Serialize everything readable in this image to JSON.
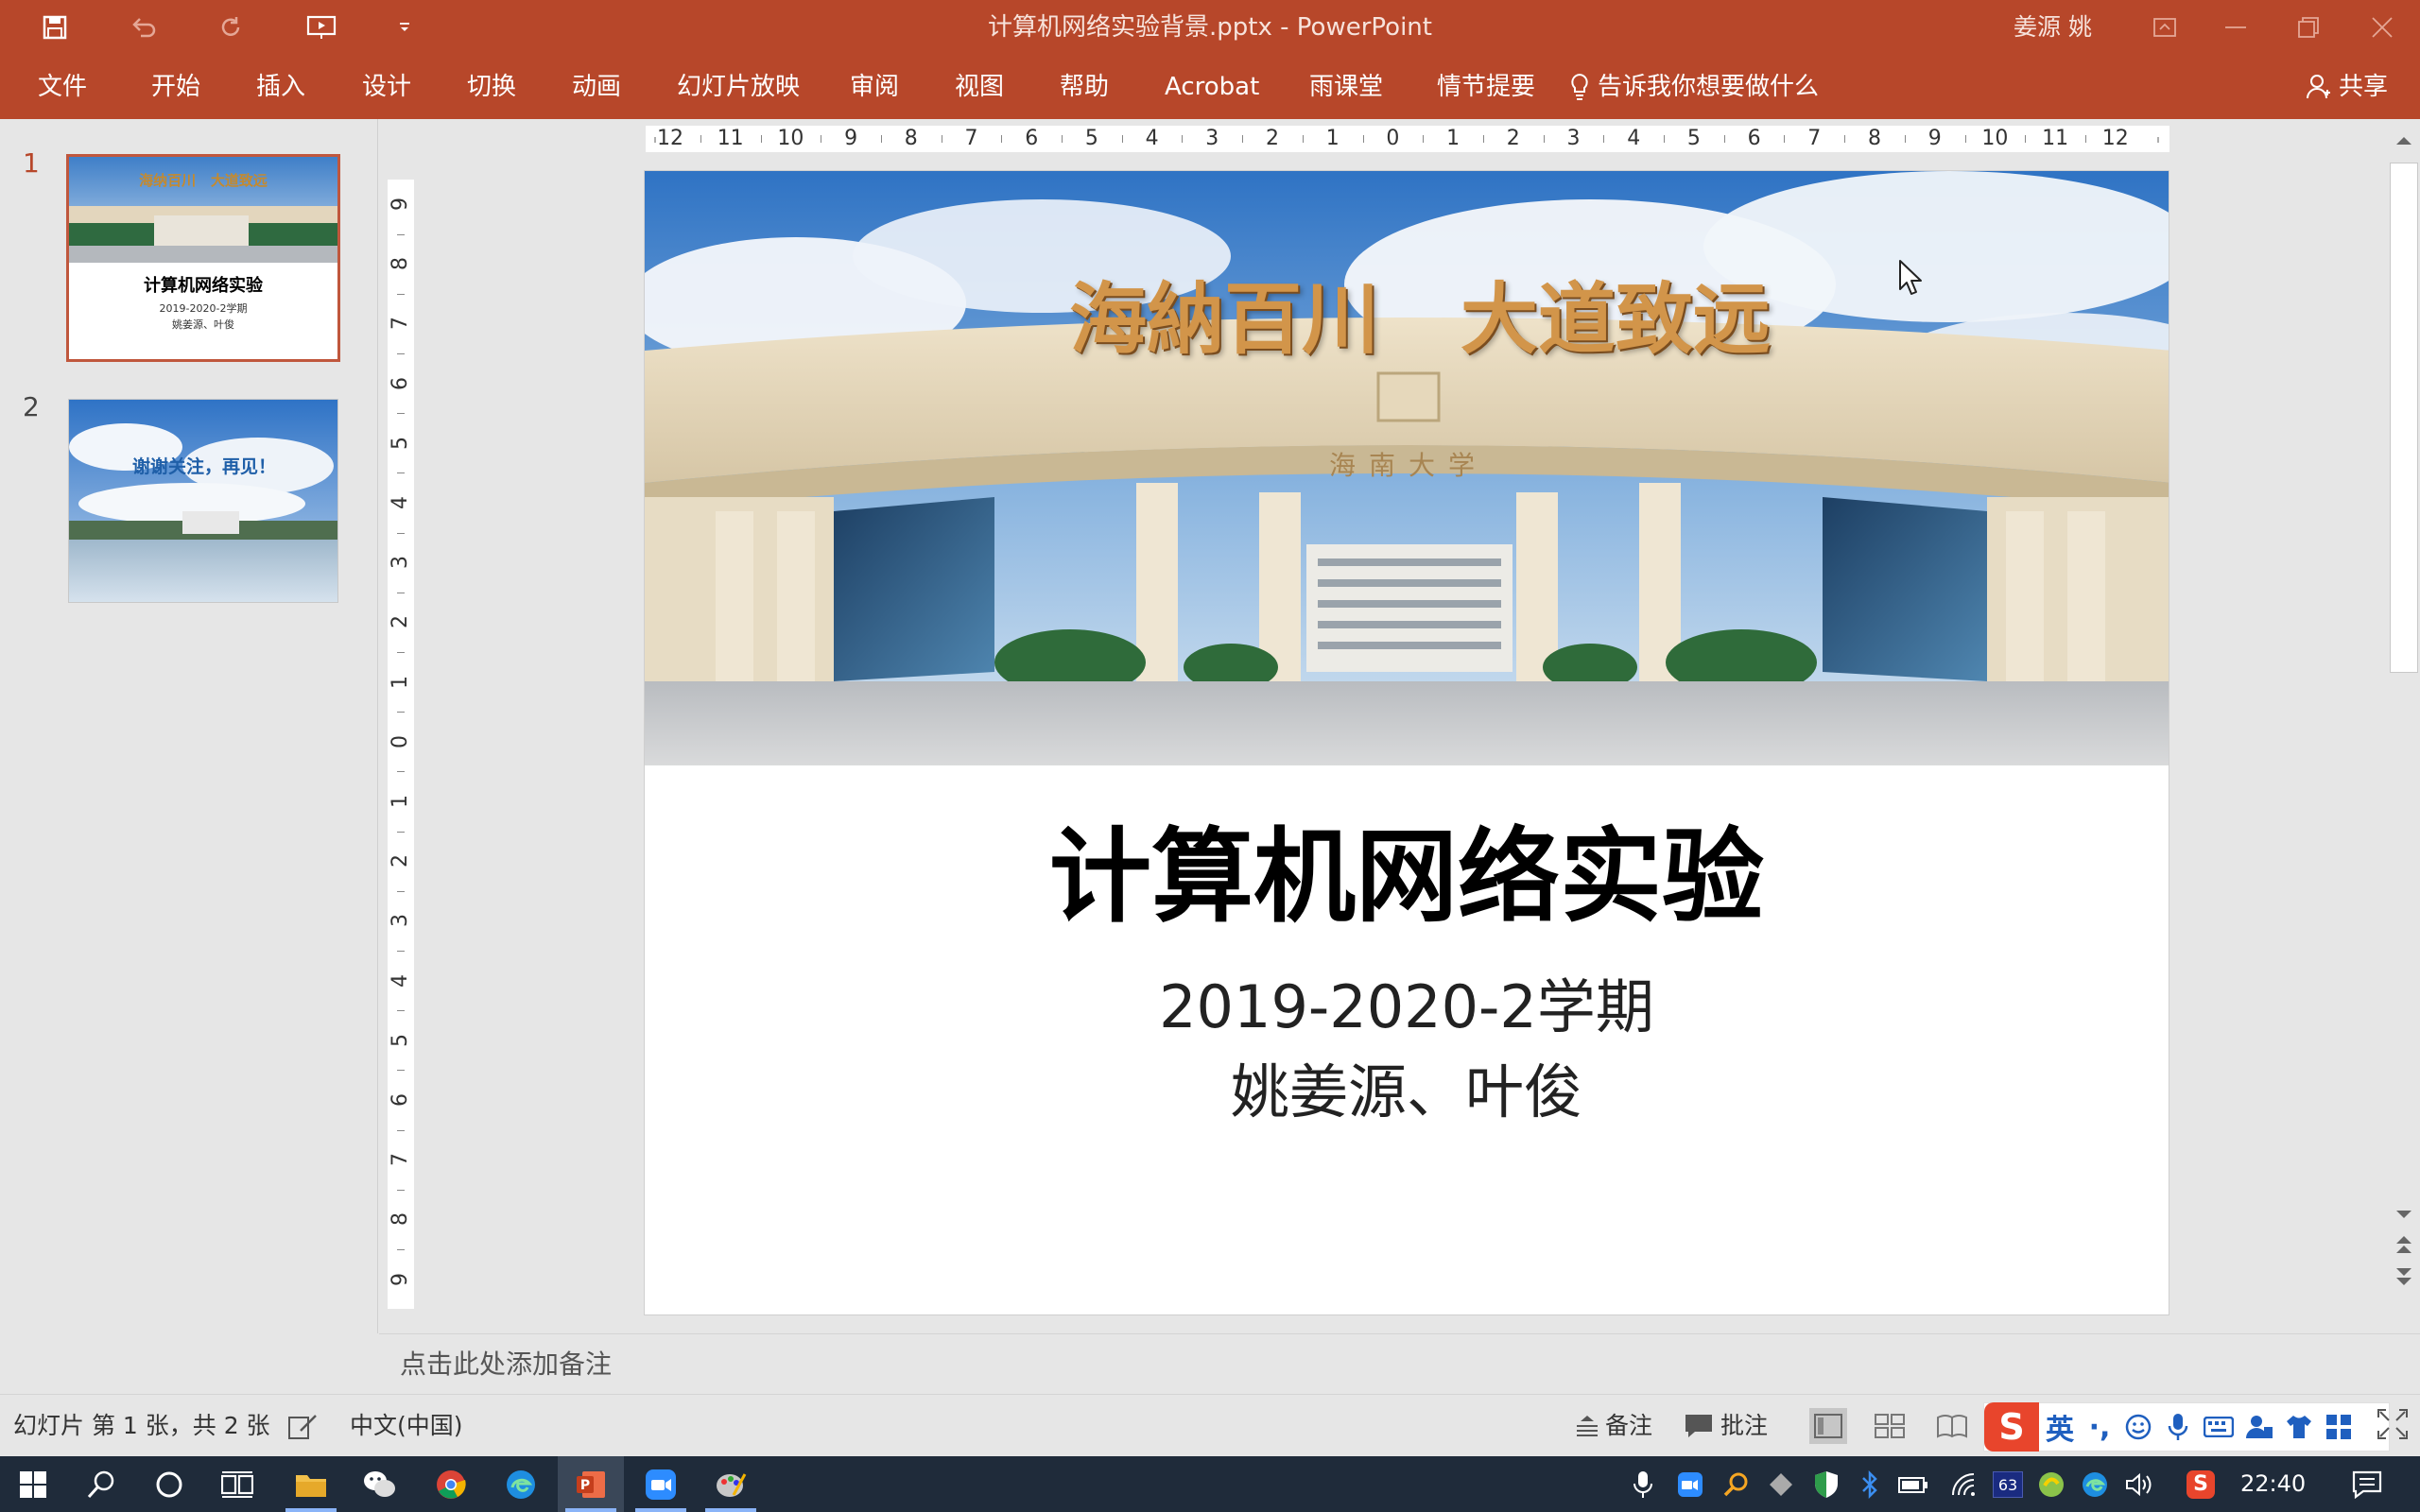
{
  "window": {
    "title": "计算机网络实验背景.pptx  -  PowerPoint",
    "user": "姜源 姚"
  },
  "ribbon": {
    "tabs": [
      "文件",
      "开始",
      "插入",
      "设计",
      "切换",
      "动画",
      "幻灯片放映",
      "审阅",
      "视图",
      "帮助",
      "Acrobat",
      "雨课堂",
      "情节提要"
    ],
    "tell_me": "告诉我你想要做什么",
    "share": "共享"
  },
  "thumbnails": [
    {
      "number": "1",
      "title": "计算机网络实验",
      "sub1": "2019-2020-2学期",
      "sub2": "姚姜源、叶俊",
      "banner": "海纳百川   大道致远"
    },
    {
      "number": "2",
      "text": "谢谢关注，再见！"
    }
  ],
  "ruler": {
    "h_ticks": [
      "12",
      "11",
      "10",
      "9",
      "8",
      "7",
      "6",
      "5",
      "4",
      "3",
      "2",
      "1",
      "0",
      "1",
      "2",
      "3",
      "4",
      "5",
      "6",
      "7",
      "8",
      "9",
      "10",
      "11",
      "12"
    ],
    "v_ticks": [
      "9",
      "8",
      "7",
      "6",
      "5",
      "4",
      "3",
      "2",
      "1",
      "0",
      "1",
      "2",
      "3",
      "4",
      "5",
      "6",
      "7",
      "8",
      "9"
    ]
  },
  "slide": {
    "banner_text": "海納百川   大道致远",
    "gate_text": "海南大学",
    "title": "计算机网络实验",
    "subtitle_line1": "2019-2020-2学期",
    "subtitle_line2": "姚姜源、叶俊"
  },
  "notes": {
    "placeholder": "点击此处添加备注"
  },
  "status": {
    "slide_info": "幻灯片 第 1 张，共 2 张",
    "language": "中文(中国)",
    "notes_label": "备注",
    "comments_label": "批注"
  },
  "ime": {
    "mode": "英"
  },
  "taskbar": {
    "time": "22:40",
    "badge": "63"
  },
  "colors": {
    "brand": "#b7472a",
    "taskbar": "#1f2b3a",
    "sogou": "#e8452c"
  }
}
